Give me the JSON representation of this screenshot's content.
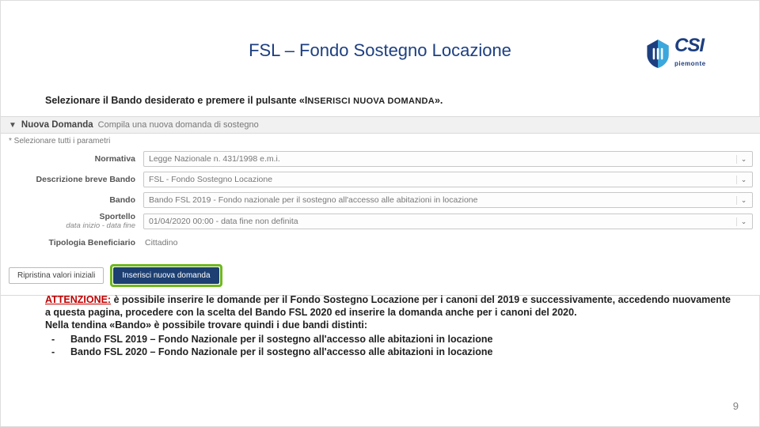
{
  "header": {
    "title": "FSL – Fondo Sostegno Locazione",
    "logo_main": "CSI",
    "logo_sub": "piemonte"
  },
  "instruction": {
    "pre": "Selezionare il Bando desiderato e premere il pulsante «I",
    "smallcaps": "NSERISCI NUOVA DOMANDA",
    "post": "»."
  },
  "panel": {
    "title": "Nuova Domanda",
    "subtitle": "Compila una nuova domanda di sostegno",
    "mandatory": "* Selezionare tutti i parametri",
    "rows": {
      "normativa_label": "Normativa",
      "normativa_value": "Legge Nazionale n. 431/1998 e.m.i.",
      "descr_label": "Descrizione breve Bando",
      "descr_value": "FSL - Fondo Sostegno Locazione",
      "bando_label": "Bando",
      "bando_value": "Bando FSL 2019 - Fondo nazionale per il sostegno all'accesso alle abitazioni in locazione",
      "sportello_label": "Sportello",
      "sportello_sub": "data inizio - data fine",
      "sportello_value": "01/04/2020 00:00 - data fine non definita",
      "tipologia_label": "Tipologia Beneficiario",
      "tipologia_value": "Cittadino"
    },
    "buttons": {
      "reset": "Ripristina valori iniziali",
      "submit": "Inserisci nuova domanda"
    }
  },
  "attention": {
    "label": "ATTENZIONE:",
    "body1": " è possibile inserire le domande per il Fondo Sostegno Locazione per i canoni del 2019 e successivamente, accedendo nuovamente a questa pagina, procedere con la scelta del Bando FSL 2020 ed inserire la domanda anche per i canoni del 2020.",
    "body2": "Nella tendina «Bando» è possibile trovare quindi i due bandi distinti:",
    "item1": "Bando FSL 2019 – Fondo Nazionale per il sostegno all'accesso alle abitazioni in locazione",
    "item2": "Bando FSL 2020 – Fondo Nazionale per il sostegno all'accesso alle abitazioni in locazione"
  },
  "page_number": "9"
}
